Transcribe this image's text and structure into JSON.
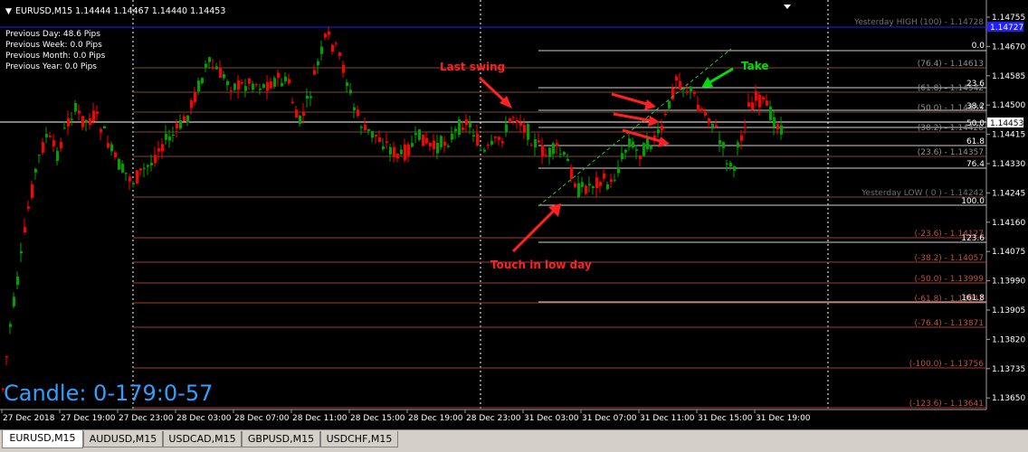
{
  "window": {
    "title": "EURUSD,M15  1.14444 1.14467 1.14440 1.14453",
    "symbol": "EURUSD",
    "timeframe": "M15",
    "ohlc": {
      "open": "1.14444",
      "high": "1.14467",
      "low": "1.14440",
      "close": "1.14453"
    }
  },
  "info_panel": [
    "Previous Day: 48.6 Pips",
    "Previous Week: 0.0 Pips",
    "Previous Month: 0.0 Pips",
    "Previous Year: 0.0 Pips"
  ],
  "candle_timer": "Candle:  0-179:0-57",
  "price_axis": {
    "ticks": [
      "1.14755",
      "1.14670",
      "1.14585",
      "1.14500",
      "1.14415",
      "1.14330",
      "1.14245",
      "1.14160",
      "1.14075",
      "1.13990",
      "1.13905",
      "1.13820",
      "1.13735",
      "1.13650"
    ],
    "current_price": "1.14453",
    "blue_label": "1.14727"
  },
  "time_axis": {
    "ticks": [
      "27 Dec 2018",
      "27 Dec 19:00",
      "27 Dec 23:00",
      "28 Dec 03:00",
      "28 Dec 07:00",
      "28 Dec 11:00",
      "28 Dec 15:00",
      "28 Dec 19:00",
      "28 Dec 23:00",
      "31 Dec 03:00",
      "31 Dec 07:00",
      "31 Dec 11:00",
      "31 Dec 15:00",
      "31 Dec 19:00"
    ]
  },
  "levels": {
    "yesterday_high": "Yesterday HIGH  (100) - 1.14728",
    "yesterday_low": "Yesterday LOW  ( 0 ) - 1.14242",
    "left_fib": [
      "(76.4) - 1.14613",
      "(61.8) - 1.14542",
      "(50.0) - 1.14485",
      "(38.2) - 1.14428",
      "(23.6) - 1.14357",
      "(-23.6) - 1.14127",
      "(-38.2) - 1.14057",
      "(-50.0) - 1.13999",
      "(-61.8) - 1.13942",
      "(-76.4) - 1.13871",
      "(-100.0) - 1.13756",
      "(-123.6) - 1.13641"
    ],
    "right_fib": [
      "0.0",
      "23.6",
      "38.2",
      "50.0",
      "61.8",
      "76.4",
      "100.0",
      "123.6",
      "161.8"
    ]
  },
  "annotations": {
    "last_swing": "Last swing",
    "touch_low": "Touch in low day",
    "take": "Take"
  },
  "tabs": [
    "EURUSD,M15",
    "AUDUSD,M15",
    "USDCAD,M15",
    "GBPUSD,M15",
    "USDCHF,M15"
  ],
  "colors": {
    "bull": "#00a000",
    "bear": "#ff0000",
    "current_line": "#ffffff",
    "high_line": "#0000ff",
    "left_fib": "#a04030",
    "right_fib": "#c0c0c0",
    "annotation_red": "#ff2020",
    "annotation_green": "#00dd00",
    "candle_timer": "#2fa0ff",
    "yesterday_levels": "#909090"
  }
}
